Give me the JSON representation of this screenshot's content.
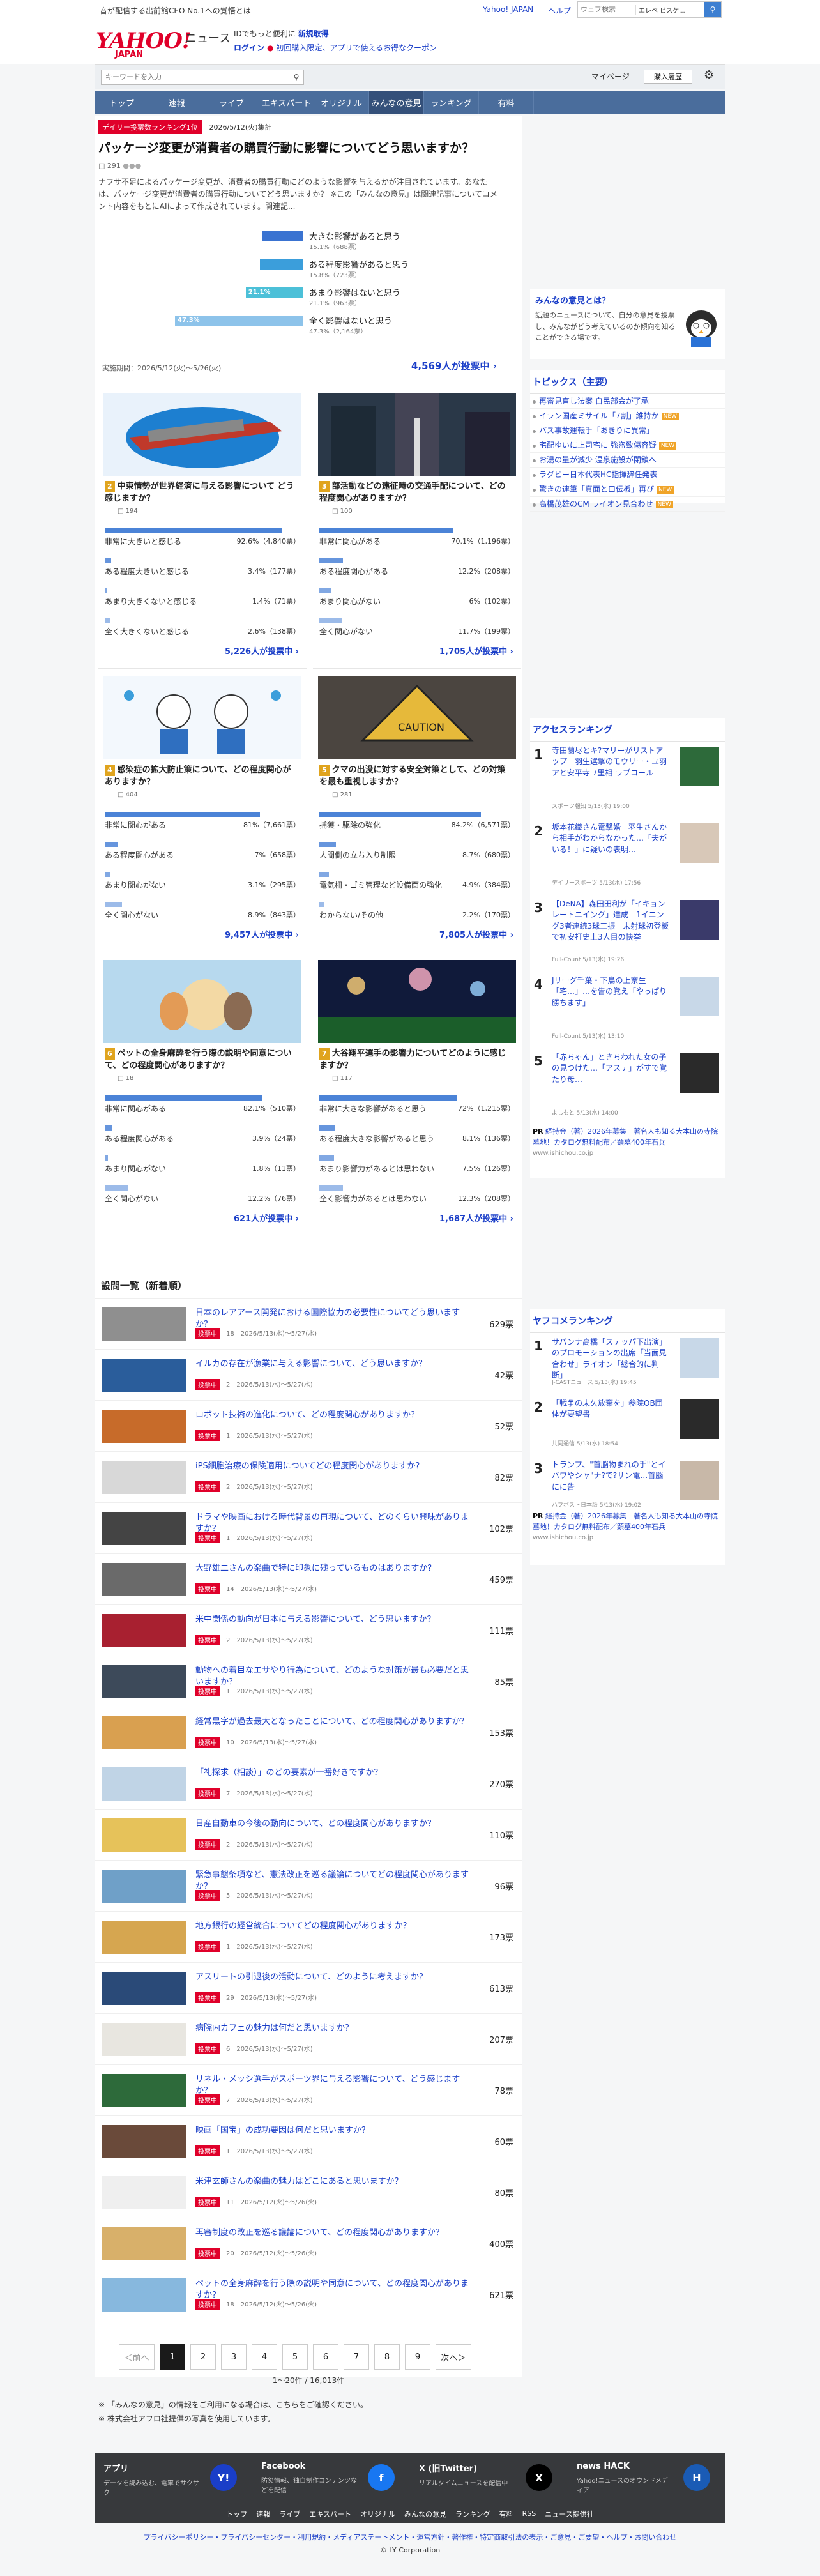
{
  "topbar": {
    "promo": "音が配信する出前館CEO No.1への覚悟とは",
    "yahoo_japan": "Yahoo! JAPAN",
    "help": "ヘルプ",
    "search_placeholder": "ウェブ検索",
    "search_scope": "エレベ ビスケ..."
  },
  "brand": {
    "logo": "YAHOO!",
    "logo_sub": "JAPAN",
    "section": "ニュース",
    "promo1_a": "IDでもっと便利に",
    "promo1_b": "新規取得",
    "login": "ログイン",
    "coupon": "初回購入限定、アプリで使えるお得なクーポン"
  },
  "subsearch": {
    "placeholder": "キーワードを入力",
    "mypage": "マイページ",
    "purchased": "購入履歴"
  },
  "gnav": [
    "トップ",
    "速報",
    "ライブ",
    "エキスパート",
    "オリジナル",
    "みんなの意見",
    "ランキング",
    "有料"
  ],
  "gnav_active": 5,
  "featured": {
    "badge": "デイリー投票数ランキング1位",
    "date": "2026/5/12(火)集計",
    "title": "パッケージ変更が消費者の購買行動に影響についてどう思いますか？",
    "comments": "291",
    "desc": "ナフサ不足によるパッケージ変更が、消費者の購買行動にどのような影響を与えるかが注目されています。あなたは、パッケージ変更が消費者の購買行動についてどう思いますか？ ※この「みんなの意見」は関連記事についてコメント内容をもとにAIによって作成されています。関連記...",
    "options": [
      {
        "label": "大きな影響があると思う",
        "pct_text": "15.1%（688票）",
        "pct": 15.1,
        "color": "#3a73d1"
      },
      {
        "label": "ある程度影響があると思う",
        "pct_text": "15.8%（723票）",
        "pct": 15.8,
        "color": "#3b9edb"
      },
      {
        "label": "あまり影響はないと思う",
        "pct_text": "21.1%（963票）",
        "pct": 21.1,
        "color": "#4cc0d8",
        "on_bar": "21.1%"
      },
      {
        "label": "全く影響はないと思う",
        "pct_text": "47.3%（2,164票）",
        "pct": 47.3,
        "color": "#8dc3ea",
        "on_bar": "47.3%"
      }
    ],
    "period": "実施期間：2026/5/12(火)〜5/26(火)",
    "total": "4,569人が投票中"
  },
  "cards": [
    {
      "num": "2",
      "title": "中東情勢が世界経済に与える影響について どう感じますか？",
      "meta": "194",
      "opts": [
        {
          "t": "非常に大きいと感じる",
          "v": "92.6%（4,840票）",
          "p": 92.6
        },
        {
          "t": "ある程度大きいと感じる",
          "v": "3.4%（177票）",
          "p": 3.4
        },
        {
          "t": "あまり大きくないと感じる",
          "v": "1.4%（71票）",
          "p": 1.4
        },
        {
          "t": "全く大きくないと感じる",
          "v": "2.6%（138票）",
          "p": 2.6
        }
      ],
      "total": "5,226人が投票中"
    },
    {
      "num": "3",
      "title": "部活動などの遠征時の交通手配について、どの程度関心がありますか？",
      "meta": "100",
      "opts": [
        {
          "t": "非常に関心がある",
          "v": "70.1%（1,196票）",
          "p": 70.1
        },
        {
          "t": "ある程度関心がある",
          "v": "12.2%（208票）",
          "p": 12.2
        },
        {
          "t": "あまり関心がない",
          "v": "6%（102票）",
          "p": 6
        },
        {
          "t": "全く関心がない",
          "v": "11.7%（199票）",
          "p": 11.7
        }
      ],
      "total": "1,705人が投票中"
    },
    {
      "num": "4",
      "title": "感染症の拡大防止策について、どの程度関心がありますか？",
      "meta": "404",
      "opts": [
        {
          "t": "非常に関心がある",
          "v": "81%（7,661票）",
          "p": 81
        },
        {
          "t": "ある程度関心がある",
          "v": "7%（658票）",
          "p": 7
        },
        {
          "t": "あまり関心がない",
          "v": "3.1%（295票）",
          "p": 3.1
        },
        {
          "t": "全く関心がない",
          "v": "8.9%（843票）",
          "p": 8.9
        }
      ],
      "total": "9,457人が投票中"
    },
    {
      "num": "5",
      "title": "クマの出没に対する安全対策として、どの対策を最も重視しますか？",
      "meta": "281",
      "opts": [
        {
          "t": "捕獲・駆除の強化",
          "v": "84.2%（6,571票）",
          "p": 84.2
        },
        {
          "t": "人間側の立ち入り制限",
          "v": "8.7%（680票）",
          "p": 8.7
        },
        {
          "t": "電気柵・ゴミ管理など設備面の強化",
          "v": "4.9%（384票）",
          "p": 4.9
        },
        {
          "t": "わからない/その他",
          "v": "2.2%（170票）",
          "p": 2.2
        }
      ],
      "total": "7,805人が投票中"
    },
    {
      "num": "6",
      "title": "ペットの全身麻酔を行う際の説明や同意について、どの程度関心がありますか？",
      "meta": "18",
      "opts": [
        {
          "t": "非常に関心がある",
          "v": "82.1%（510票）",
          "p": 82.1
        },
        {
          "t": "ある程度関心がある",
          "v": "3.9%（24票）",
          "p": 3.9
        },
        {
          "t": "あまり関心がない",
          "v": "1.8%（11票）",
          "p": 1.8
        },
        {
          "t": "全く関心がない",
          "v": "12.2%（76票）",
          "p": 12.2
        }
      ],
      "total": "621人が投票中"
    },
    {
      "num": "7",
      "title": "大谷翔平選手の影響力についてどのように感じますか？",
      "meta": "117",
      "opts": [
        {
          "t": "非常に大きな影響があると思う",
          "v": "72%（1,215票）",
          "p": 72
        },
        {
          "t": "ある程度大きな影響があると思う",
          "v": "8.1%（136票）",
          "p": 8.1
        },
        {
          "t": "あまり影響力があるとは思わない",
          "v": "7.5%（126票）",
          "p": 7.5
        },
        {
          "t": "全く影響力があるとは思わない",
          "v": "12.3%（208票）",
          "p": 12.3
        }
      ],
      "total": "1,687人が投票中"
    }
  ],
  "questions_heading": "設問一覧（新着順）",
  "questions": [
    {
      "q": "日本のレアアース開発における国際協力の必要性についてどう思いますか？",
      "meta": "18　2026/5/13(水)〜5/27(水)",
      "n": "629票"
    },
    {
      "q": "イルカの存在が漁業に与える影響について、どう思いますか？",
      "meta": "2　2026/5/13(水)〜5/27(水)",
      "n": "42票"
    },
    {
      "q": "ロボット技術の進化について、どの程度関心がありますか？",
      "meta": "1　2026/5/13(水)〜5/27(水)",
      "n": "52票"
    },
    {
      "q": "iPS細胞治療の保険適用についてどの程度関心がありますか？",
      "meta": "2　2026/5/13(水)〜5/27(水)",
      "n": "82票"
    },
    {
      "q": "ドラマや映画における時代背景の再現について、どのくらい興味がありますか？",
      "meta": "1　2026/5/13(水)〜5/27(水)",
      "n": "102票"
    },
    {
      "q": "大野雄二さんの楽曲で特に印象に残っているものはありますか？",
      "meta": "14　2026/5/13(水)〜5/27(水)",
      "n": "459票"
    },
    {
      "q": "米中関係の動向が日本に与える影響について、どう思いますか？",
      "meta": "2　2026/5/13(水)〜5/27(水)",
      "n": "111票"
    },
    {
      "q": "動物への着目なエサやり行為について、どのような対策が最も必要だと思いますか？",
      "meta": "1　2026/5/13(水)〜5/27(水)",
      "n": "85票"
    },
    {
      "q": "経常黒字が過去最大となったことについて、どの程度関心がありますか？",
      "meta": "10　2026/5/13(水)〜5/27(水)",
      "n": "153票"
    },
    {
      "q": "「礼探求（相談）」のどの要素が一番好きですか？",
      "meta": "7　2026/5/13(水)〜5/27(水)",
      "n": "270票"
    },
    {
      "q": "日産自動車の今後の動向について、どの程度関心がありますか？",
      "meta": "2　2026/5/13(水)〜5/27(水)",
      "n": "110票"
    },
    {
      "q": "緊急事態条項など、憲法改正を巡る議論についてどの程度関心がありますか？",
      "meta": "5　2026/5/13(水)〜5/27(水)",
      "n": "96票"
    },
    {
      "q": "地方銀行の経営統合についてどの程度関心がありますか？",
      "meta": "1　2026/5/13(水)〜5/27(水)",
      "n": "173票"
    },
    {
      "q": "アスリートの引退後の活動について、どのように考えますか？",
      "meta": "29　2026/5/13(水)〜5/27(水)",
      "n": "613票"
    },
    {
      "q": "病院内カフェの魅力は何だと思いますか？",
      "meta": "6　2026/5/13(水)〜5/27(水)",
      "n": "207票"
    },
    {
      "q": "リネル・メッシ選手がスポーツ界に与える影響について、どう感じますか？",
      "meta": "7　2026/5/13(水)〜5/27(水)",
      "n": "78票"
    },
    {
      "q": "映画「国宝」の成功要因は何だと思いますか？",
      "meta": "1　2026/5/13(水)〜5/27(水)",
      "n": "60票"
    },
    {
      "q": "米津玄師さんの楽曲の魅力はどこにあると思いますか？",
      "meta": "11　2026/5/12(火)〜5/26(火)",
      "n": "80票"
    },
    {
      "q": "再審制度の改正を巡る議論について、どの程度関心がありますか？",
      "meta": "20　2026/5/12(火)〜5/26(火)",
      "n": "400票"
    },
    {
      "q": "ペットの全身麻酔を行う際の説明や同意について、どの程度関心がありますか？",
      "meta": "18　2026/5/12(火)〜5/26(火)",
      "n": "621票"
    }
  ],
  "vote_badge": "投票中",
  "pager": {
    "prev": "＜前へ",
    "pages": [
      "1",
      "2",
      "3",
      "4",
      "5",
      "6",
      "7",
      "8",
      "9"
    ],
    "next": "次へ＞",
    "summary": "1〜20件 / 16,013件"
  },
  "notes": [
    "「みんなの意見」の情報をご利用になる場合は、こちらをご確認ください。",
    "株式会社アフロ社提供の写真を使用しています。"
  ],
  "side": {
    "about_title": "みんなの意見とは？",
    "about_text": "話題のニュースについて、自分の意見を投票し、みんながどう考えているのか傾向を知ることができる場です。",
    "topics_title": "トピックス（主要）",
    "topics": [
      {
        "t": "再審見直し法案 自民部会が了承",
        "tag": ""
      },
      {
        "t": "イラン国産ミサイル「7割」維持か",
        "tag": "NEW"
      },
      {
        "t": "バス事故運転手「あきりに異常」",
        "tag": ""
      },
      {
        "t": "宅配ゆいに上司宅に 強盗致傷容疑",
        "tag": "NEW"
      },
      {
        "t": "お湯の量が減少 温泉施設が閉鎖へ",
        "tag": ""
      },
      {
        "t": "ラグビー日本代表HC指揮辞任発表",
        "tag": ""
      },
      {
        "t": "驚きの連筆「真面と口伝板」再び",
        "tag": "NEW"
      },
      {
        "t": "高橋茂雄のCM ライオン見合わせ",
        "tag": "NEW"
      }
    ],
    "access_title": "アクセスランキング",
    "access": [
      {
        "no": "1",
        "t": "寺田蘭尽とキ?マリーがリストアップ　羽生選撃のモウリー・ユ羽アと安平寺 7里相 ラブコール",
        "s": "スポーツ報知 5/13(水) 19:00"
      },
      {
        "no": "2",
        "t": "坂本花織さん電撃婚　羽生さんから相手がわからなかった…「夫がいる！」に疑いの表明…",
        "s": "デイリースポーツ 5/13(水) 17:56"
      },
      {
        "no": "3",
        "t": "【DeNA】森田田利が「イキョンレートニイング」達成　1イニング3者連続3球三振　未射球初登板で初安打史上3人目の快挙",
        "s": "Full-Count 5/13(水) 19:26"
      },
      {
        "no": "4",
        "t": "Jリーグ千葉・下鳥の上奈生「宅…」…を告の覚え「やっぱり勝ちます」",
        "s": "Full-Count 5/13(水) 13:10"
      },
      {
        "no": "5",
        "t": "「赤ちゃん」ときちわれた女の子の見つけた…「アステ」がすで覚たり母…",
        "s": "よしもと 5/13(水) 14:00"
      }
    ],
    "pr1": {
      "label": "PR",
      "t": "経持金（著）2026年募集　著名人も知る大本山の寺院墓地！カタログ無料配布／顕墓400年石兵",
      "s": "www.ishichou.co.jp"
    },
    "yahoo_title": "ヤフコメランキング",
    "yahoo": [
      {
        "no": "1",
        "t": "サバンナ高橋「ステッパ下出演」のプロモーションの出席「当面見合わせ」ライオン「総合的に判断」",
        "s": "J-CASTニュース 5/13(水) 19:45"
      },
      {
        "no": "2",
        "t": "「戦争の未久放棄を」参院OB団体が要望書",
        "s": "共同通信 5/13(水) 18:54"
      },
      {
        "no": "3",
        "t": "トランプ、\"首脳物まれの手\"とイバワやシャ\"ナ?で?サン電…首脳にに告",
        "s": "ハフポスト日本版 5/13(水) 19:02"
      }
    ],
    "pr2": {
      "label": "PR",
      "t": "経持金（著）2026年募集　著名人も知る大本山の寺院墓地！カタログ無料配布／顕墓400年石兵",
      "s": "www.ishichou.co.jp"
    }
  },
  "footer": {
    "apps": [
      {
        "title": "アプリ",
        "text": "データを読み込む、電車でサクサク"
      },
      {
        "title": "Facebook",
        "text": "防災情報、独自制作コンテンツなどを配信"
      },
      {
        "title": "X (旧Twitter)",
        "text": "リアルタイムニュースを配信中"
      },
      {
        "title": "news HACK",
        "text": "Yahoo!ニュースのオウンドメディア"
      }
    ],
    "nav": [
      "トップ",
      "速報",
      "ライブ",
      "エキスパート",
      "オリジナル",
      "みんなの意見",
      "ランキング",
      "有料",
      "RSS",
      "ニュース提供社"
    ],
    "links": "プライバシーポリシー・プライバシーセンター・利用規約・メディアステートメント・運営方針・著作権・特定商取引法の表示・ご意見・ご要望・ヘルプ・お問い合わせ",
    "copyright": "© LY Corporation"
  }
}
